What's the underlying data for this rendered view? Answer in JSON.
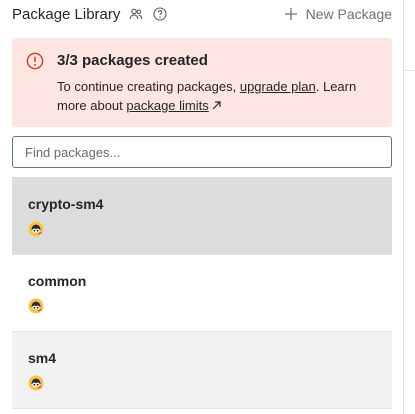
{
  "header": {
    "title": "Package Library",
    "new_package_label": "New Package",
    "icons": [
      "users-icon",
      "help-icon",
      "plus-icon"
    ]
  },
  "alert": {
    "title": "3/3 packages created",
    "body_prefix": "To continue creating packages, ",
    "upgrade_link": "upgrade plan",
    "body_middle": ". Learn more about ",
    "limits_link": "package limits",
    "colors": {
      "background": "#fde5e1",
      "icon": "#d4422a"
    }
  },
  "search": {
    "placeholder": "Find packages...",
    "value": ""
  },
  "packages": [
    {
      "name": "crypto-sm4",
      "state": "selected"
    },
    {
      "name": "common",
      "state": "default"
    },
    {
      "name": "sm4",
      "state": "default"
    }
  ]
}
